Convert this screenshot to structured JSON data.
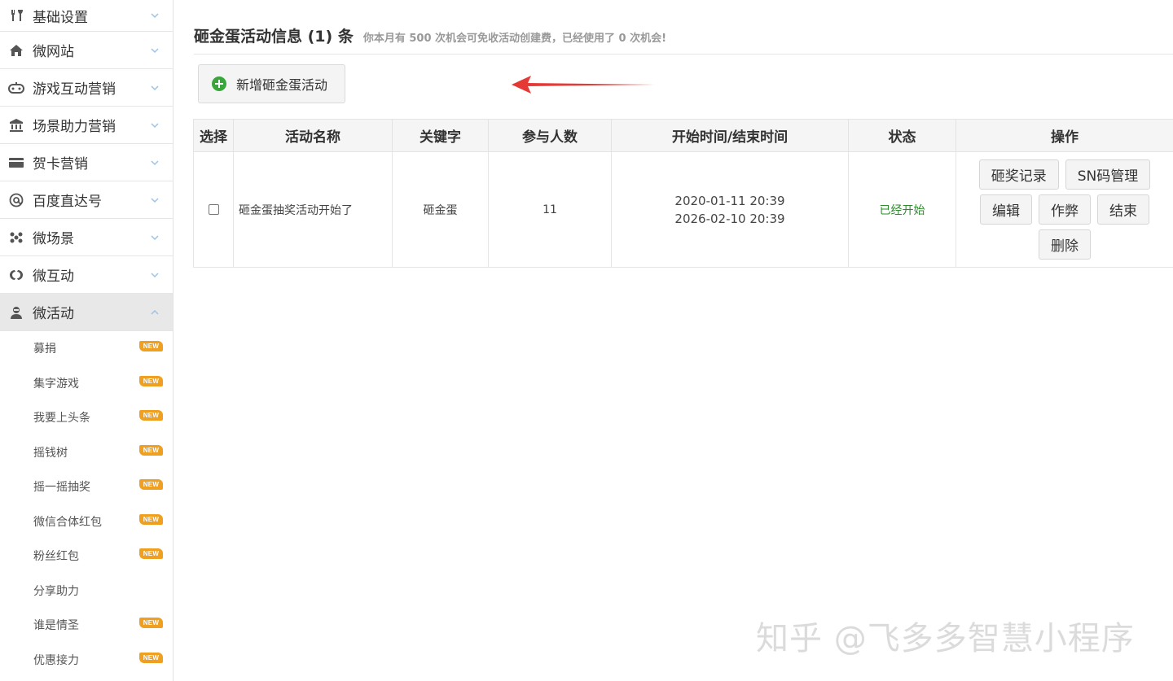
{
  "sidebar": {
    "menu": [
      {
        "label": "基础设置",
        "icon": "tools-icon"
      },
      {
        "label": "微网站",
        "icon": "home-icon"
      },
      {
        "label": "游戏互动营销",
        "icon": "gamepad-icon"
      },
      {
        "label": "场景助力营销",
        "icon": "bank-icon"
      },
      {
        "label": "贺卡营销",
        "icon": "card-icon"
      },
      {
        "label": "百度直达号",
        "icon": "at-icon"
      },
      {
        "label": "微场景",
        "icon": "dots-icon"
      },
      {
        "label": "微互动",
        "icon": "link-icon"
      },
      {
        "label": "微活动",
        "icon": "activity-icon"
      }
    ],
    "sub_items": [
      {
        "label": "募捐",
        "badge": "NEW"
      },
      {
        "label": "集字游戏",
        "badge": "NEW"
      },
      {
        "label": "我要上头条",
        "badge": "NEW"
      },
      {
        "label": "摇钱树",
        "badge": "NEW"
      },
      {
        "label": "摇一摇抽奖",
        "badge": "NEW"
      },
      {
        "label": "微信合体红包",
        "badge": "NEW"
      },
      {
        "label": "粉丝红包",
        "badge": "NEW"
      },
      {
        "label": "分享助力",
        "badge": ""
      },
      {
        "label": "谁是情圣",
        "badge": "NEW"
      },
      {
        "label": "优惠接力",
        "badge": "NEW"
      }
    ]
  },
  "header": {
    "title": "砸金蛋活动信息 (1) 条",
    "hint": "你本月有 500 次机会可免收活动创建费，已经使用了 0 次机会!"
  },
  "add_button": {
    "label": "新增砸金蛋活动"
  },
  "table": {
    "columns": [
      "选择",
      "活动名称",
      "关键字",
      "参与人数",
      "开始时间/结束时间",
      "状态",
      "操作"
    ],
    "rows": [
      {
        "name": "砸金蛋抽奖活动开始了",
        "keyword": "砸金蛋",
        "participants": "11",
        "start_time": "2020-01-11 20:39",
        "end_time": "2026-02-10 20:39",
        "status": "已经开始",
        "actions": [
          "砸奖记录",
          "SN码管理",
          "编辑",
          "作弊",
          "结束",
          "删除"
        ]
      }
    ]
  },
  "watermark": "知乎 @飞多多智慧小程序",
  "colors": {
    "accent_green": "#3aa53a",
    "status_green": "#2d8a2d",
    "badge_orange": "#f0a020",
    "arrow_red": "#e53935"
  }
}
